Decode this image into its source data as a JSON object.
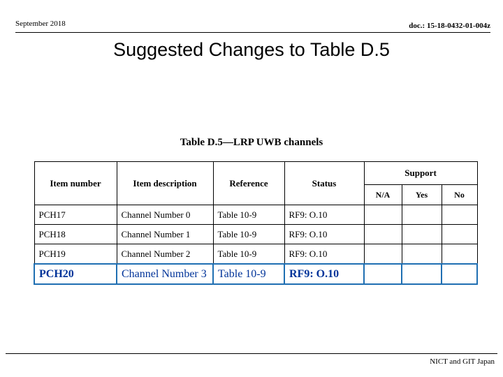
{
  "header": {
    "left": "September 2018",
    "right": "doc.: 15-18-0432-01-004z"
  },
  "title": "Suggested Changes to Table D.5",
  "table": {
    "caption": "Table D.5—LRP UWB channels",
    "headers": {
      "item_number": "Item number",
      "item_description": "Item description",
      "reference": "Reference",
      "status": "Status",
      "support": "Support",
      "support_na": "N/A",
      "support_yes": "Yes",
      "support_no": "No"
    },
    "rows": [
      {
        "item_number": "PCH17",
        "item_description": "Channel Number 0",
        "reference": "Table 10-9",
        "status": "RF9: O.10",
        "na": "",
        "yes": "",
        "no": "",
        "highlight": false
      },
      {
        "item_number": "PCH18",
        "item_description": "Channel Number 1",
        "reference": "Table 10-9",
        "status": "RF9: O.10",
        "na": "",
        "yes": "",
        "no": "",
        "highlight": false
      },
      {
        "item_number": "PCH19",
        "item_description": "Channel Number 2",
        "reference": "Table 10-9",
        "status": "RF9: O.10",
        "na": "",
        "yes": "",
        "no": "",
        "highlight": false
      },
      {
        "item_number": "PCH20",
        "item_description": "Channel Number 3",
        "reference": "Table 10-9",
        "status": "RF9: O.10",
        "na": "",
        "yes": "",
        "no": "",
        "highlight": true
      }
    ]
  },
  "footer": {
    "text": "NICT and GIT Japan"
  },
  "colors": {
    "highlight_border": "#1F6FB2",
    "highlight_text": "#003399",
    "body_text": "#000000"
  }
}
